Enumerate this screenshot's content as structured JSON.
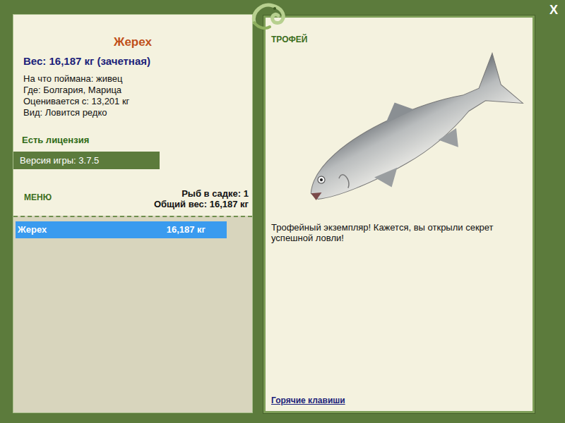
{
  "fish": {
    "name": "Жерех",
    "weight": "Вес: 16,187 кг (зачетная)",
    "details": [
      "На что поймана: живец",
      "Где: Болгария, Марица",
      "Оценивается с: 13,201 кг",
      "Вид: Ловится редко"
    ]
  },
  "license": "Есть лицензия",
  "version": "Версия игры: 3.7.5",
  "menu": {
    "label": "МЕНЮ",
    "count": "Рыб в садке: 1",
    "total": "Общий вес: 16,187 кг"
  },
  "keepnet": [
    {
      "name": "Жерех",
      "weight": "16,187 кг",
      "selected": true
    }
  ],
  "trophy": {
    "label": "ТРОФЕЙ",
    "message": "Трофейный экземпляр! Кажется, вы открыли секрет успешной ловли!"
  },
  "hotkeys": "Горячие клавиши",
  "close": "X"
}
